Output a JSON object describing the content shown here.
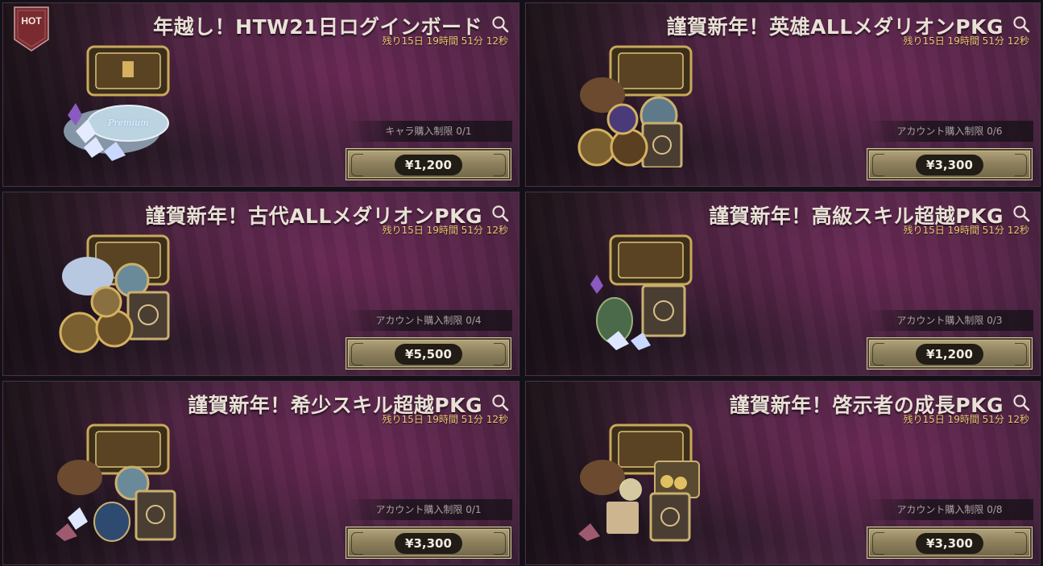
{
  "badge": {
    "hot": "HOT"
  },
  "products": [
    {
      "title": "年越し！HTW21日ログインボード",
      "timer": "残り15日 19時間 51分 12秒",
      "limit": "キャラ購入制限 0/1",
      "price": "¥1,200",
      "tag": "Premium"
    },
    {
      "title": "謹賀新年！英雄ALLメダリオンPKG",
      "timer": "残り15日 19時間 51分 12秒",
      "limit": "アカウント購入制限 0/6",
      "price": "¥3,300"
    },
    {
      "title": "謹賀新年！古代ALLメダリオンPKG",
      "timer": "残り15日 19時間 51分 12秒",
      "limit": "アカウント購入制限 0/4",
      "price": "¥5,500"
    },
    {
      "title": "謹賀新年！高級スキル超越PKG",
      "timer": "残り15日 19時間 51分 12秒",
      "limit": "アカウント購入制限 0/3",
      "price": "¥1,200"
    },
    {
      "title": "謹賀新年！希少スキル超越PKG",
      "timer": "残り15日 19時間 51分 12秒",
      "limit": "アカウント購入制限 0/1",
      "price": "¥3,300"
    },
    {
      "title": "謹賀新年！啓示者の成長PKG",
      "timer": "残り15日 19時間 51分 12秒",
      "limit": "アカウント購入制限 0/8",
      "price": "¥3,300"
    }
  ],
  "icons": {
    "search": "magnifier-icon",
    "art": "treasure-chest-bundle-icon"
  },
  "colors": {
    "timer": "#f2c877",
    "title": "#e9e0d6",
    "button_gold": "#b6a77d",
    "pill": "#221c17",
    "card_purple": "#5a2a4e",
    "hot_badge": "#7a2b30"
  }
}
